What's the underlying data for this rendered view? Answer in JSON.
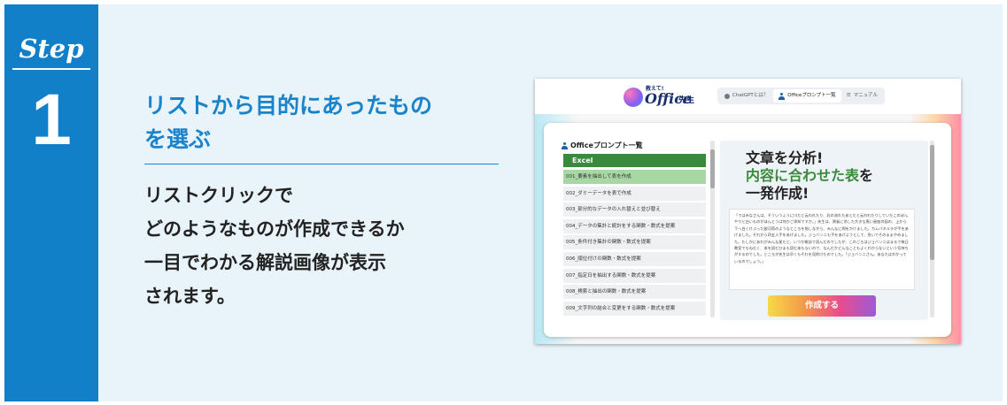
{
  "step": {
    "word": "Step",
    "number": "1"
  },
  "heading": [
    "リストから目的にあったもの",
    "を選ぶ"
  ],
  "description": [
    "リストクリックで",
    "どのようなものが作成できるか",
    "一目でわかる解説画像が表示",
    "されます。"
  ],
  "screenshot": {
    "logo": {
      "tagline": "教えて!",
      "brand": "Office",
      "suffix": "先生"
    },
    "nav": [
      {
        "label": "ChatGPTとは？",
        "icon": "question-circle-icon"
      },
      {
        "label": "Officeプロンプト一覧",
        "icon": "person-icon"
      },
      {
        "label": "マニュアル",
        "icon": "list-icon"
      }
    ],
    "list_title": "Officeプロンプト一覧",
    "category": "Excel",
    "items": [
      "001_要素を抽出して表を作成",
      "002_ダミーデータを表で作成",
      "003_部分的なデータの入れ替えと並び替え",
      "004_データの集計と統計をする関数・数式を提案",
      "005_条件付き集計の関数・数式を提案",
      "006_順位付けの関数・数式を提案",
      "007_指定日を抽出する関数・数式を提案",
      "008_検索と抽出の関数・数式を提案",
      "009_文字列の結合と変更をする関数・数式を提案"
    ],
    "preview_title": {
      "line1": "文章を分析!",
      "line2_green": "内容に合わせた表",
      "line2_rest": "を",
      "line3": "一発作成!"
    },
    "preview_text": "「ではみなさんは、そういうふうに川だと云われたり、乳の流れたあとだと云われたりしていたこのぼんやりと白いものがほんとうは何かご承知ですか。」先生は、黒板に吊した大きな黒い星座の図の、上から下へ白くけぶった銀河帯のようなところを指しながら、みんなに問をかけました。カムパネルラが手をあげました。それから四五人手をあげました。ジョバンニも手をあげようとして、急いでそのままやめました。たしかにあれがみんな星だと、いつか雑誌で読んだのでしたが、このごろはジョバンニはまるで毎日教室でもねむく、本を読むひまも読む本もないので、なんだかどんなこともよくわからないという気持ちがするのでした。ところが先生は早くもそれを見附けたのでした。「ジョバンニさん。あなたはわかっているのでしょう。」",
    "button": "作成する"
  }
}
